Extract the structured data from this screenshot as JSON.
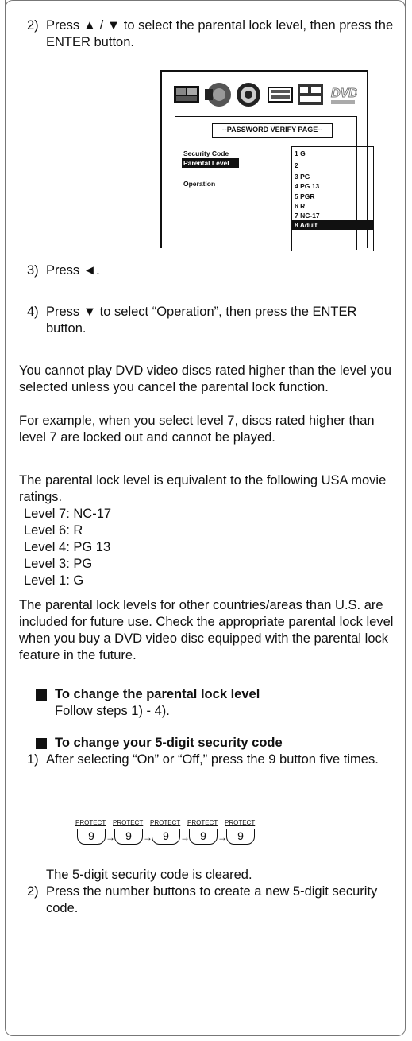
{
  "step2": {
    "num": "2)",
    "text": "Press ▲ / ▼ to select the parental lock level, then press the ENTER button."
  },
  "osd": {
    "icons": [
      "picture-icon",
      "audio-icon",
      "speaker-icon",
      "display-icon",
      "parental-icon",
      "dvd-icon"
    ],
    "title": "--PASSWORD VERIFY PAGE--",
    "options": [
      "Security Code",
      "Parental Level",
      "Operation"
    ],
    "levels": [
      "1  G",
      "2",
      "3  PG",
      "4  PG 13",
      "5  PGR",
      "6  R",
      "7  NC-17",
      "8  Adult"
    ],
    "dvd_caption": "DVD"
  },
  "step3": {
    "num": "3)",
    "text": "Press ◄."
  },
  "step4": {
    "num": "4)",
    "text": "Press ▼ to select “Operation”, then press the ENTER button."
  },
  "para1": "You cannot play DVD video discs rated higher than the level you selected unless you cancel the parental lock function.",
  "para2": "For example, when you select level 7, discs rated higher than level 7 are locked out and cannot be played.",
  "para3": "The parental lock level is equivalent to the following USA movie ratings.",
  "ratings": [
    "Level 7: NC-17",
    "Level 6: R",
    "Level 4: PG 13",
    "Level 3: PG",
    "Level 1: G"
  ],
  "para4": "The parental lock levels for other countries/areas than U.S. are included for future use. Check the appropriate parental lock level when you buy a DVD video disc equipped with the parental lock feature in the future.",
  "section1": {
    "heading": "To change the parental lock level",
    "body": "Follow steps 1) - 4)."
  },
  "section2": {
    "heading": "To change your 5-digit security code",
    "step1_num": "1)",
    "step1": "After selecting “On” or “Off,” press the 9 button five times.",
    "key_label": "PROTECT",
    "key_value": "9",
    "cleared": "The 5-digit security code is cleared.",
    "step2_num": "2)",
    "step2": "Press the number buttons to create a new 5-digit security code."
  }
}
